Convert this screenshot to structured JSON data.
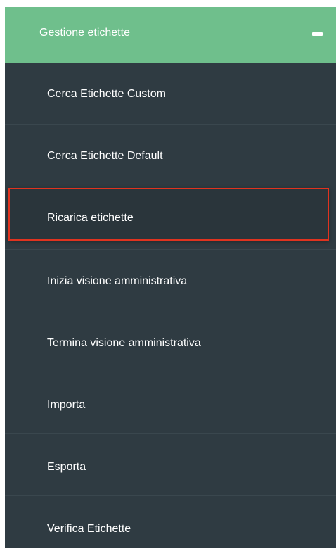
{
  "menu": {
    "header": {
      "title": "Gestione etichette",
      "collapse_icon": "minus-icon",
      "background_color": "#6fbf8c"
    },
    "background_color": "#2f3b42",
    "highlight_color": "#e0331f",
    "items": [
      {
        "label": "Cerca Etichette Custom"
      },
      {
        "label": "Cerca Etichette Default"
      },
      {
        "label": "Ricarica etichette",
        "highlighted": true
      },
      {
        "label": "Inizia visione amministrativa"
      },
      {
        "label": "Termina visione amministrativa"
      },
      {
        "label": "Importa"
      },
      {
        "label": "Esporta"
      },
      {
        "label": "Verifica Etichette"
      }
    ]
  }
}
